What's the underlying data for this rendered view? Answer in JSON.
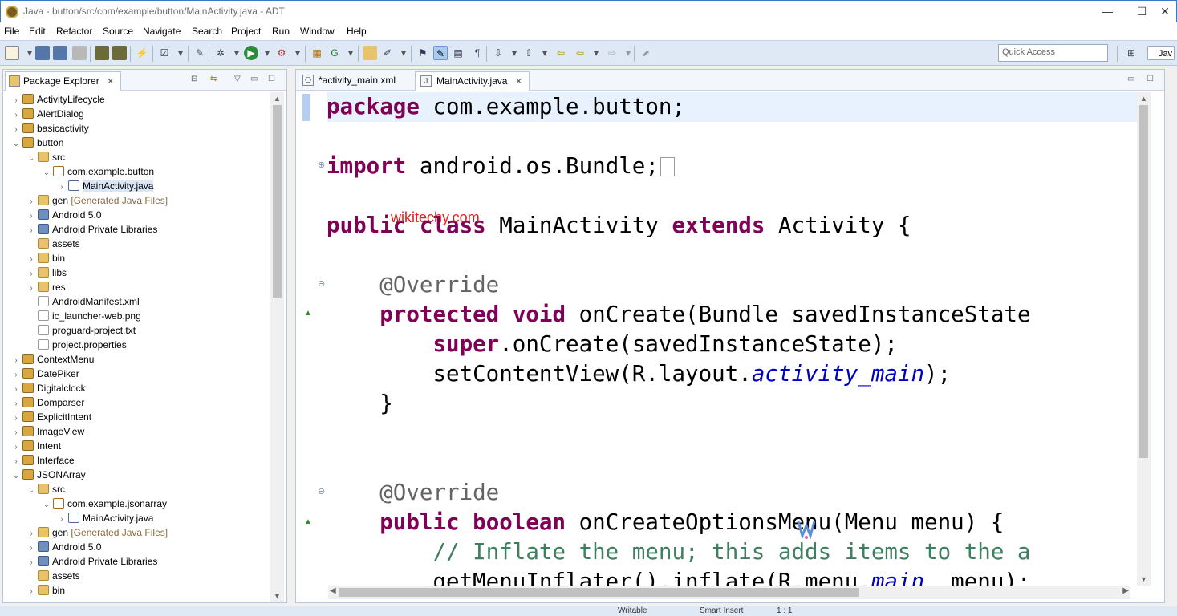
{
  "window": {
    "title": "Java - button/src/com/example/button/MainActivity.java - ADT",
    "min": "—",
    "max": "☐",
    "close": "✕"
  },
  "menu": [
    "File",
    "Edit",
    "Refactor",
    "Source",
    "Navigate",
    "Search",
    "Project",
    "Run",
    "Window",
    "Help"
  ],
  "toolbar": {
    "quick_access_placeholder": "Quick Access",
    "perspective_label": "Jav"
  },
  "explorer": {
    "title": "Package Explorer",
    "tree": [
      {
        "label": "ActivityLifecycle",
        "type": "project",
        "depth": 0,
        "twisty": "collapsed"
      },
      {
        "label": "AlertDialog",
        "type": "project",
        "depth": 0,
        "twisty": "collapsed"
      },
      {
        "label": "basicactivity",
        "type": "project",
        "depth": 0,
        "twisty": "collapsed"
      },
      {
        "label": "button",
        "type": "project",
        "depth": 0,
        "twisty": "expanded"
      },
      {
        "label": "src",
        "type": "folder",
        "depth": 1,
        "twisty": "expanded"
      },
      {
        "label": "com.example.button",
        "type": "pkg",
        "depth": 2,
        "twisty": "expanded"
      },
      {
        "label": "MainActivity.java",
        "type": "java",
        "depth": 3,
        "twisty": "collapsed",
        "selected": true
      },
      {
        "label": "gen",
        "suffix": "[Generated Java Files]",
        "type": "folder",
        "depth": 1,
        "twisty": "collapsed"
      },
      {
        "label": "Android 5.0",
        "type": "lib",
        "depth": 1,
        "twisty": "collapsed"
      },
      {
        "label": "Android Private Libraries",
        "type": "lib",
        "depth": 1,
        "twisty": "collapsed"
      },
      {
        "label": "assets",
        "type": "folder",
        "depth": 1,
        "twisty": "none"
      },
      {
        "label": "bin",
        "type": "folder",
        "depth": 1,
        "twisty": "collapsed"
      },
      {
        "label": "libs",
        "type": "folder",
        "depth": 1,
        "twisty": "collapsed"
      },
      {
        "label": "res",
        "type": "folder",
        "depth": 1,
        "twisty": "collapsed"
      },
      {
        "label": "AndroidManifest.xml",
        "type": "file",
        "depth": 1,
        "twisty": "none"
      },
      {
        "label": "ic_launcher-web.png",
        "type": "file",
        "depth": 1,
        "twisty": "none"
      },
      {
        "label": "proguard-project.txt",
        "type": "file",
        "depth": 1,
        "twisty": "none"
      },
      {
        "label": "project.properties",
        "type": "file",
        "depth": 1,
        "twisty": "none"
      },
      {
        "label": "ContextMenu",
        "type": "project",
        "depth": 0,
        "twisty": "collapsed"
      },
      {
        "label": "DatePiker",
        "type": "project",
        "depth": 0,
        "twisty": "collapsed"
      },
      {
        "label": "Digitalclock",
        "type": "project",
        "depth": 0,
        "twisty": "collapsed"
      },
      {
        "label": "Domparser",
        "type": "project",
        "depth": 0,
        "twisty": "collapsed"
      },
      {
        "label": "ExplicitIntent",
        "type": "project",
        "depth": 0,
        "twisty": "collapsed"
      },
      {
        "label": "ImageView",
        "type": "project",
        "depth": 0,
        "twisty": "collapsed"
      },
      {
        "label": "Intent",
        "type": "project",
        "depth": 0,
        "twisty": "collapsed"
      },
      {
        "label": "Interface",
        "type": "project",
        "depth": 0,
        "twisty": "collapsed"
      },
      {
        "label": "JSONArray",
        "type": "project",
        "depth": 0,
        "twisty": "expanded"
      },
      {
        "label": "src",
        "type": "folder",
        "depth": 1,
        "twisty": "expanded"
      },
      {
        "label": "com.example.jsonarray",
        "type": "pkg",
        "depth": 2,
        "twisty": "expanded"
      },
      {
        "label": "MainActivity.java",
        "type": "java",
        "depth": 3,
        "twisty": "collapsed"
      },
      {
        "label": "gen",
        "suffix": "[Generated Java Files]",
        "type": "folder",
        "depth": 1,
        "twisty": "collapsed"
      },
      {
        "label": "Android 5.0",
        "type": "lib",
        "depth": 1,
        "twisty": "collapsed"
      },
      {
        "label": "Android Private Libraries",
        "type": "lib",
        "depth": 1,
        "twisty": "collapsed"
      },
      {
        "label": "assets",
        "type": "folder",
        "depth": 1,
        "twisty": "none"
      },
      {
        "label": "bin",
        "type": "folder",
        "depth": 1,
        "twisty": "collapsed"
      }
    ]
  },
  "editor": {
    "tabs": [
      {
        "label": "*activity_main.xml",
        "active": false
      },
      {
        "label": "MainActivity.java",
        "active": true
      }
    ],
    "watermark": "wikitechy.com",
    "code": [
      [
        {
          "t": "package",
          "c": "kw"
        },
        {
          "t": " com.example.button;",
          "c": ""
        }
      ],
      [],
      [
        {
          "t": "import",
          "c": "kw"
        },
        {
          "t": " android.os.Bundle;",
          "c": ""
        }
      ],
      [],
      [
        {
          "t": "public",
          "c": "kw"
        },
        {
          "t": " ",
          "c": ""
        },
        {
          "t": "class",
          "c": "kw"
        },
        {
          "t": " MainActivity ",
          "c": ""
        },
        {
          "t": "extends",
          "c": "kw"
        },
        {
          "t": " Activity {",
          "c": ""
        }
      ],
      [],
      [
        {
          "t": "    ",
          "c": ""
        },
        {
          "t": "@Override",
          "c": "ann"
        }
      ],
      [
        {
          "t": "    ",
          "c": ""
        },
        {
          "t": "protected",
          "c": "kw"
        },
        {
          "t": " ",
          "c": ""
        },
        {
          "t": "void",
          "c": "kw"
        },
        {
          "t": " onCreate(Bundle savedInstanceState",
          "c": ""
        }
      ],
      [
        {
          "t": "        ",
          "c": ""
        },
        {
          "t": "super",
          "c": "kw"
        },
        {
          "t": ".onCreate(savedInstanceState);",
          "c": ""
        }
      ],
      [
        {
          "t": "        setContentView(R.layout.",
          "c": ""
        },
        {
          "t": "activity_main",
          "c": "fld"
        },
        {
          "t": ");",
          "c": ""
        }
      ],
      [
        {
          "t": "    }",
          "c": ""
        }
      ],
      [],
      [],
      [
        {
          "t": "    ",
          "c": ""
        },
        {
          "t": "@Override",
          "c": "ann"
        }
      ],
      [
        {
          "t": "    ",
          "c": ""
        },
        {
          "t": "public",
          "c": "kw"
        },
        {
          "t": " ",
          "c": ""
        },
        {
          "t": "boolean",
          "c": "kw"
        },
        {
          "t": " onCreateOptionsMenu(Menu menu) {",
          "c": ""
        }
      ],
      [
        {
          "t": "        ",
          "c": ""
        },
        {
          "t": "// Inflate the menu; this adds items to the a",
          "c": "cmt"
        }
      ],
      [
        {
          "t": "        getMenuInflater().inflate(R.menu.",
          "c": ""
        },
        {
          "t": "main",
          "c": "fld"
        },
        {
          "t": ", menu);",
          "c": ""
        }
      ]
    ]
  },
  "status": {
    "writable": "Writable",
    "insert": "Smart Insert",
    "position": "1 : 1"
  }
}
